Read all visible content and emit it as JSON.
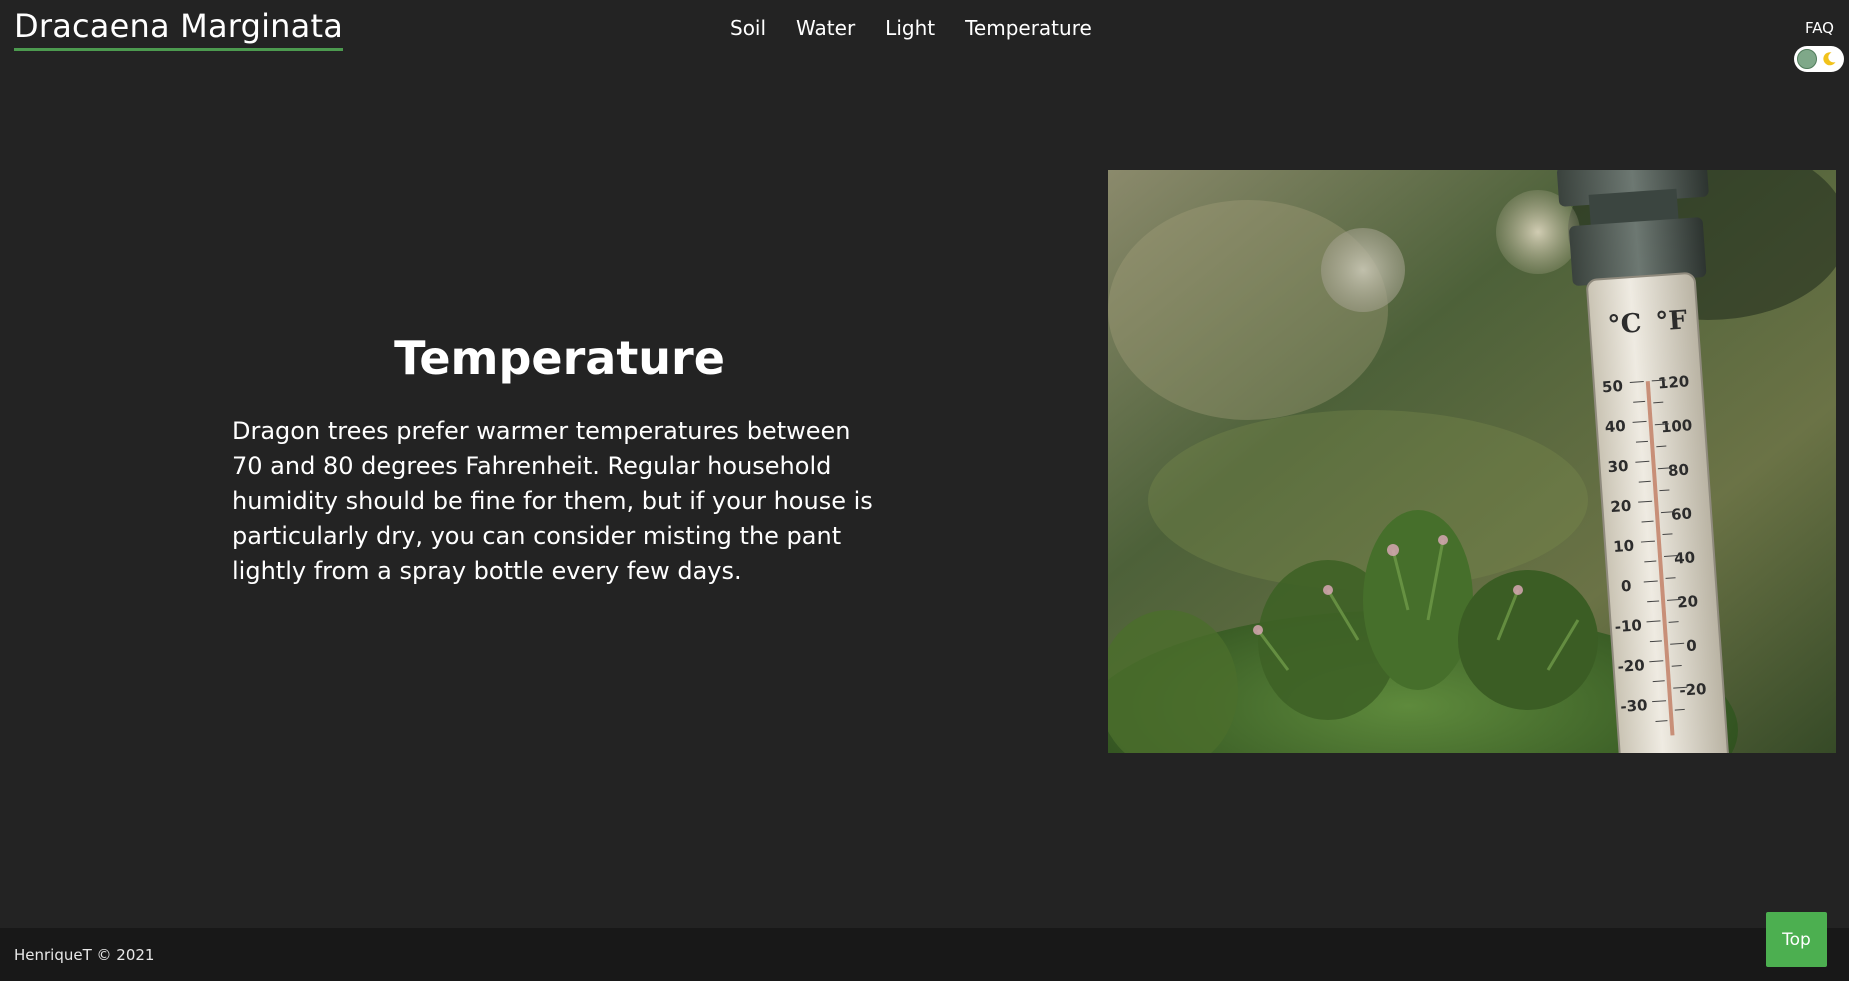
{
  "header": {
    "brand": "Dracaena Marginata",
    "nav": [
      "Soil",
      "Water",
      "Light",
      "Temperature"
    ],
    "faq": "FAQ",
    "theme_toggle_icon": "moon-icon"
  },
  "main": {
    "title": "Temperature",
    "body": "Dragon trees prefer warmer temperatures between 70 and 80 degrees Fahrenheit. Regular household humidity should be fine for them, but if your house is particularly dry, you can consider misting the pant lightly from a spray bottle every few days.",
    "image": {
      "description_icon": "thermometer-photo",
      "scale_c_label": "°C",
      "scale_f_label": "°F",
      "celsius_ticks": [
        "50",
        "40",
        "30",
        "20",
        "10",
        "0",
        "-10",
        "-20",
        "-30"
      ],
      "fahrenheit_ticks": [
        "120",
        "100",
        "80",
        "60",
        "40",
        "20",
        "0",
        "-20"
      ]
    }
  },
  "footer": {
    "copyright": "HenriqueT © 2021",
    "top_button": "Top"
  },
  "colors": {
    "background": "#232323",
    "footer": "#181818",
    "accent": "#4caf50",
    "brand_underline": "#4c9a4f"
  }
}
